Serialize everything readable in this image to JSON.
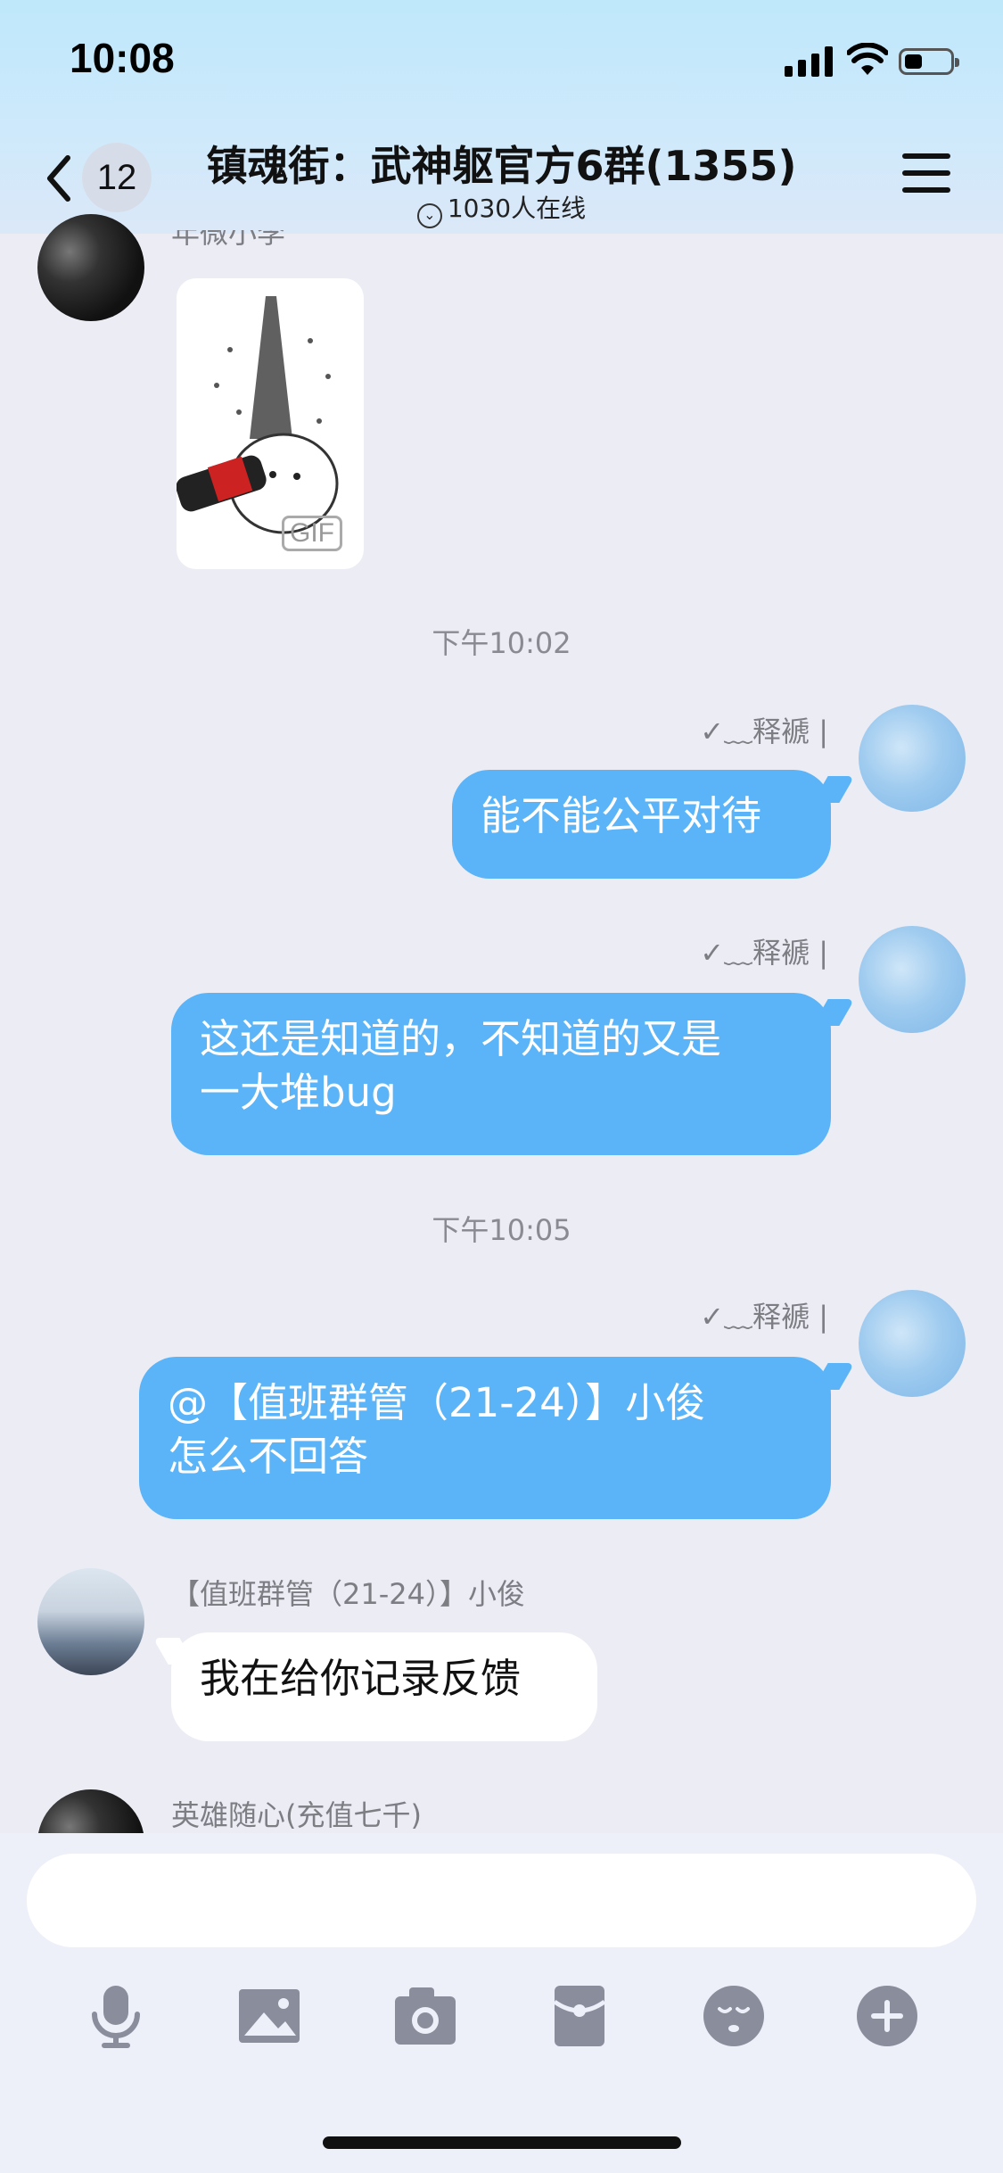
{
  "status_bar": {
    "time": "10:08"
  },
  "header": {
    "back_count": "12",
    "title": "镇魂街：武神躯官方6群(1355)",
    "online": "1030人在线"
  },
  "messages": [
    {
      "sender": "年微小李",
      "type": "gif",
      "gif_label": "GIF",
      "side": "left"
    },
    {
      "timestamp": "下午10:02"
    },
    {
      "sender": "✓﹏释褫 |",
      "text": "能不能公平对待",
      "side": "right"
    },
    {
      "sender": "✓﹏释褫 |",
      "text_lines": [
        "这还是知道的，不知道的又是",
        "一大堆bug"
      ],
      "side": "right"
    },
    {
      "timestamp": "下午10:05"
    },
    {
      "sender": "✓﹏释褫 |",
      "text_lines": [
        "@【值班群管（21-24）】小俊",
        "怎么不回答"
      ],
      "side": "right"
    },
    {
      "sender": "【值班群管（21-24）】小俊",
      "text": "我在给你记录反馈",
      "side": "left"
    },
    {
      "sender": "英雄随心(充值七千)",
      "side": "left"
    }
  ],
  "toolbar": {
    "icons": [
      "microphone-icon",
      "image-icon",
      "camera-icon",
      "red-packet-icon",
      "emoji-icon",
      "plus-icon"
    ]
  },
  "colors": {
    "accent": "#5ab4f7",
    "background": "#ececf5"
  }
}
